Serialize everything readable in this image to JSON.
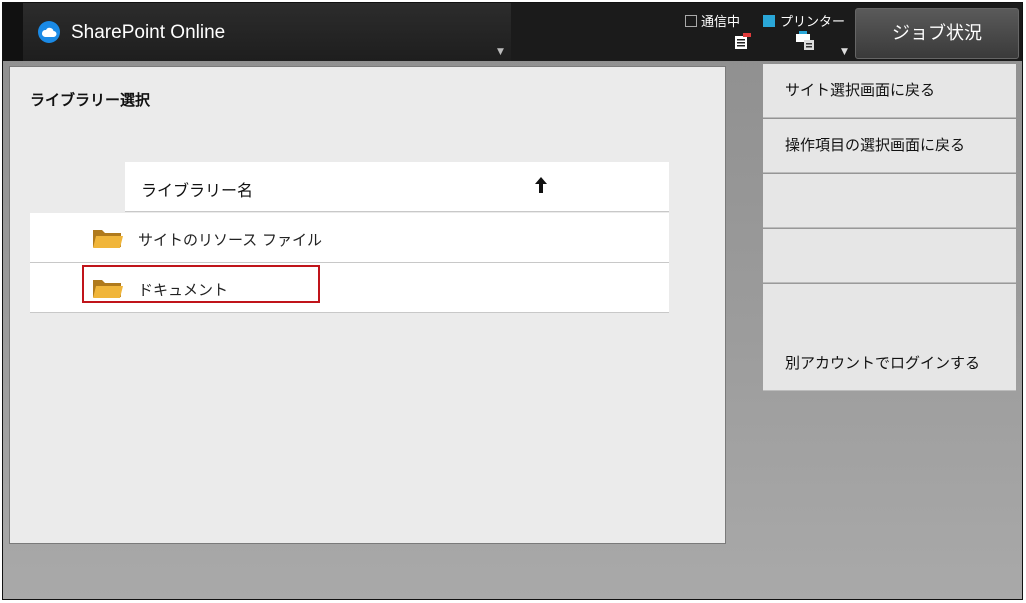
{
  "header": {
    "app_title": "SharePoint Online",
    "status_comm": "通信中",
    "status_printer": "プリンター",
    "job_status_button": "ジョブ状況",
    "accent_color": "#2aa7d8"
  },
  "main": {
    "title": "ライブラリー選択",
    "list": {
      "column_header": "ライブラリー名",
      "sort_direction": "ascending",
      "rows": [
        {
          "label": "サイトのリソース ファイル",
          "icon": "folder-icon",
          "selected": false
        },
        {
          "label": "ドキュメント",
          "icon": "folder-icon",
          "selected": true
        }
      ]
    }
  },
  "side_buttons": [
    {
      "label": "サイト選択画面に戻る"
    },
    {
      "label": "操作項目の選択画面に戻る"
    },
    {
      "label": ""
    },
    {
      "label": ""
    },
    {
      "label": ""
    },
    {
      "label": "別アカウントでログインする"
    }
  ]
}
